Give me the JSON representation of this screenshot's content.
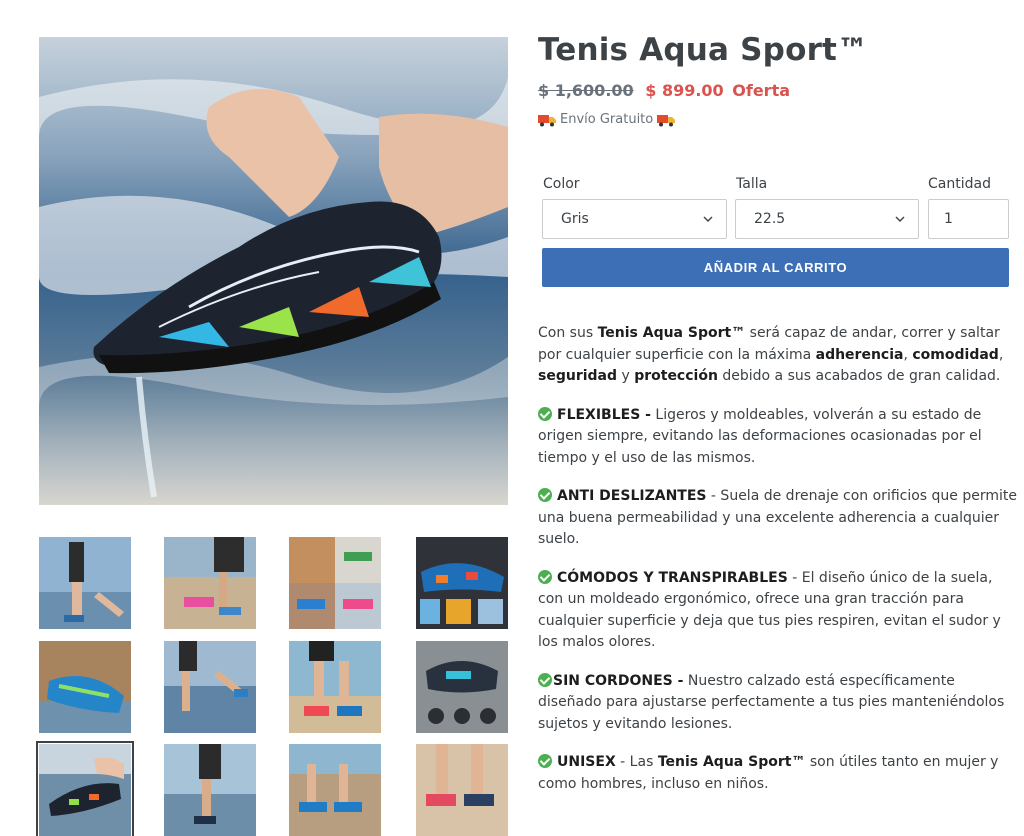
{
  "product": {
    "title": "Tenis Aqua Sport™",
    "price_compare": "$ 1,600.00",
    "price_sale": "$ 899.00",
    "sale_badge": "Oferta",
    "shipping": "Envío Gratuito"
  },
  "selectors": {
    "color_label": "Color",
    "color_value": "Gris",
    "size_label": "Talla",
    "size_value": "22.5",
    "qty_label": "Cantidad",
    "qty_value": "1"
  },
  "cart": {
    "add_label": "AÑADIR AL CARRITO"
  },
  "description": {
    "intro": {
      "t1": "Con sus ",
      "b1": "Tenis Aqua Sport™",
      "t2": " será capaz de andar, correr y saltar por cualquier superficie con la máxima ",
      "b2": "adherencia",
      "t3": ", ",
      "b3": "comodidad",
      "t4": ", ",
      "b4": "seguridad",
      "t5": " y ",
      "b5": "protección",
      "t6": " debido a sus acabados de gran calidad."
    },
    "features": [
      {
        "title": "FLEXIBLES -",
        "text": " Ligeros y moldeables, volverán a su estado de origen siempre, evitando las deformaciones ocasionadas por el tiempo y el uso de las mismos."
      },
      {
        "title": "ANTI DESLIZANTES",
        "text": " - Suela de drenaje con orificios que permite una buena permeabilidad  y una excelente adherencia a cualquier suelo."
      },
      {
        "title": "CÓMODOS Y TRANSPIRABLES",
        "text": " - El diseño único de la suela, con un moldeado ergonómico, ofrece una gran tracción para cualquier superficie y deja que tus pies respiren, evitan el sudor y los malos olores."
      },
      {
        "title": "SIN CORDONES -",
        "text": " Nuestro calzado está específicamente diseñado para ajustarse perfectamente a tus pies manteniéndolos sujetos y evitando lesiones."
      },
      {
        "title": "UNISEX",
        "text_a": " - Las ",
        "bold_mid": "Tenis Aqua Sport™",
        "text_b": " son útiles tanto en mujer y como hombres, incluso en niños."
      }
    ]
  },
  "colors": {
    "accent": "#3d6fb6",
    "sale": "#d9534f",
    "check": "#4caf50",
    "text": "#3d4246"
  },
  "icons": [
    "truck-icon",
    "chevron-down-icon",
    "check-circle-icon"
  ]
}
